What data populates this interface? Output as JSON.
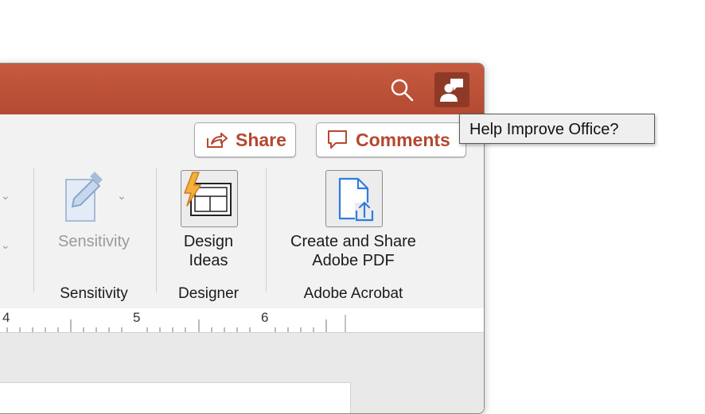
{
  "titlebar": {
    "accent_color": "#b94e35",
    "search_icon": "search-icon",
    "profile_icon": "user-feedback-icon"
  },
  "toolbar": {
    "share_label": "Share",
    "comments_label": "Comments"
  },
  "ribbon": {
    "sensitivity": {
      "tool_label": "Sensitivity",
      "group_label": "Sensitivity",
      "enabled": false
    },
    "designer": {
      "tool_label_line1": "Design",
      "tool_label_line2": "Ideas",
      "group_label": "Designer"
    },
    "acrobat": {
      "tool_label_line1": "Create and Share",
      "tool_label_line2": "Adobe PDF",
      "group_label": "Adobe Acrobat"
    }
  },
  "ruler": {
    "numbers": [
      "4",
      "5",
      "6"
    ]
  },
  "tooltip": {
    "text": "Help Improve Office?"
  }
}
